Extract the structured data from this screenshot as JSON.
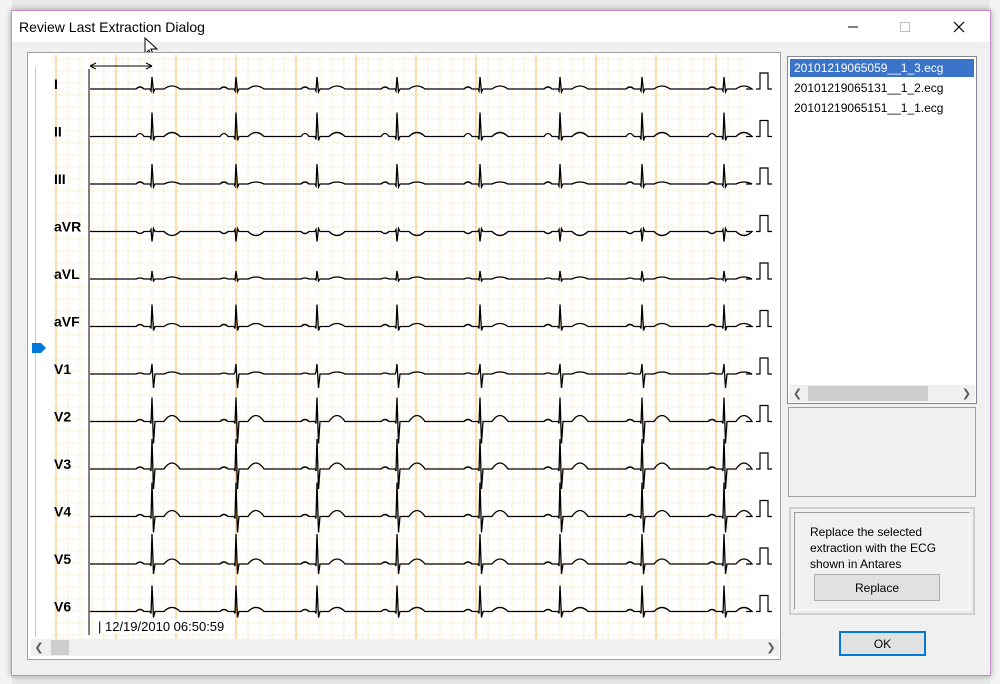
{
  "window": {
    "title": "Review Last Extraction Dialog",
    "minimize_icon": "minimize-icon",
    "maximize_icon": "maximize-icon",
    "close_icon": "close-icon"
  },
  "ecg": {
    "leads": [
      "I",
      "II",
      "III",
      "aVR",
      "aVL",
      "aVF",
      "V1",
      "V2",
      "V3",
      "V4",
      "V5",
      "V6"
    ],
    "timestamp": "| 12/19/2010 06:50:59",
    "grid_color": "#f5a623",
    "trace_color": "#000000"
  },
  "files": {
    "items": [
      "20101219065059__1_3.ecg",
      "20101219065131__1_2.ecg",
      "20101219065151__1_1.ecg"
    ],
    "selected_index": 0,
    "selected_color": "#3b73c8"
  },
  "replace_group": {
    "text": "Replace the selected extraction with the ECG shown in Antares",
    "button_label": "Replace"
  },
  "ok_label": "OK",
  "accent": "#0078d7"
}
